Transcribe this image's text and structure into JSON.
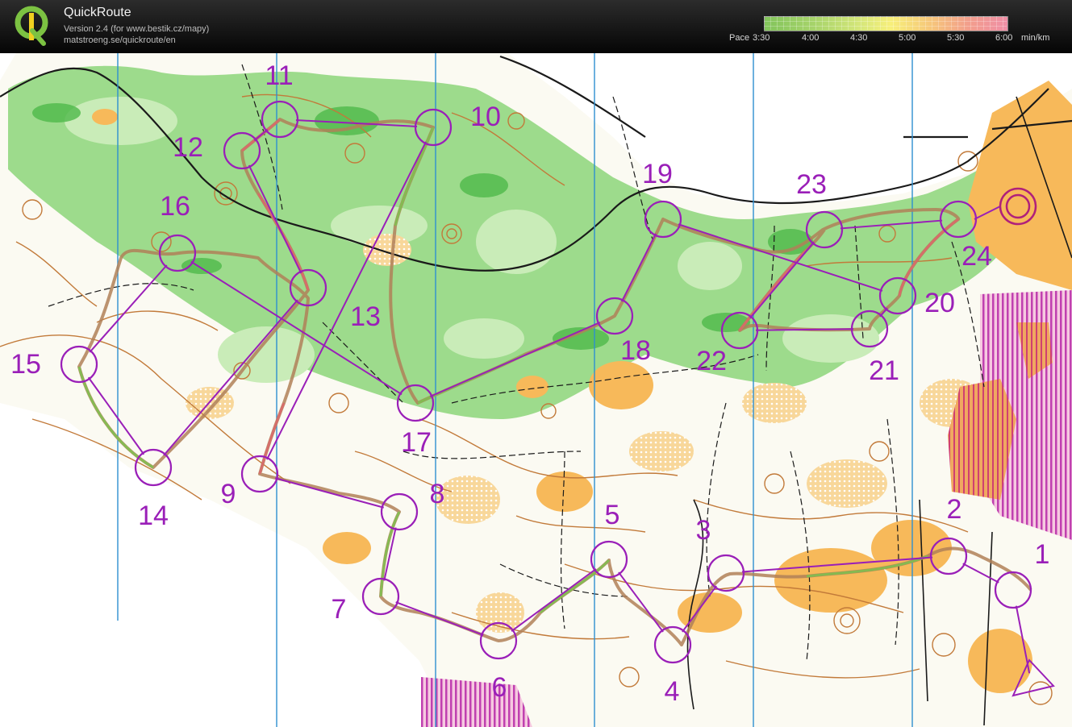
{
  "app": {
    "name": "QuickRoute",
    "version": "Version 2.4  (for www.bestik.cz/mapy)",
    "url": "matstroeng.se/quickroute/en"
  },
  "pace_legend": {
    "label": "Pace",
    "ticks": [
      "3:30",
      "4:00",
      "4:30",
      "5:00",
      "5:30",
      "6:00"
    ],
    "unit": "min/km",
    "colors": [
      "#82c45b",
      "#d7e77a",
      "#f7ef7a",
      "#f6c77a",
      "#f29e8c",
      "#ef8ea6"
    ]
  },
  "course": {
    "color": "#9a1fb8",
    "controls": [
      {
        "label": "1"
      },
      {
        "label": "2"
      },
      {
        "label": "3"
      },
      {
        "label": "4"
      },
      {
        "label": "5"
      },
      {
        "label": "6"
      },
      {
        "label": "7"
      },
      {
        "label": "8"
      },
      {
        "label": "9"
      },
      {
        "label": "10"
      },
      {
        "label": "11"
      },
      {
        "label": "12"
      },
      {
        "label": "13"
      },
      {
        "label": "14"
      },
      {
        "label": "15"
      },
      {
        "label": "16"
      },
      {
        "label": "17"
      },
      {
        "label": "18"
      },
      {
        "label": "19"
      },
      {
        "label": "20"
      },
      {
        "label": "21"
      },
      {
        "label": "22"
      },
      {
        "label": "23"
      },
      {
        "label": "24"
      }
    ]
  }
}
